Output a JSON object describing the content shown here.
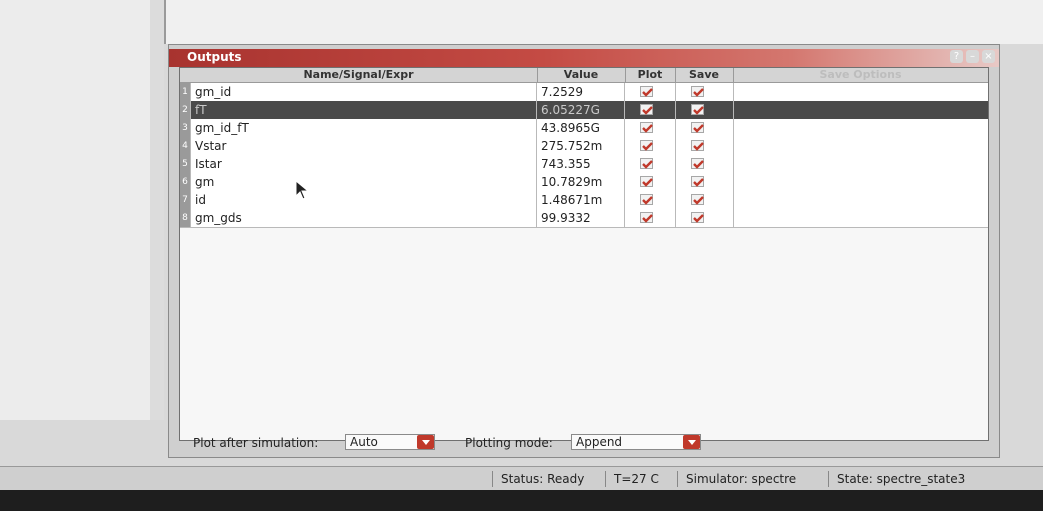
{
  "window": {
    "title": "Outputs",
    "controls": [
      "help-icon",
      "minimize-icon",
      "close-icon"
    ]
  },
  "table": {
    "columns": [
      "Name/Signal/Expr",
      "Value",
      "Plot",
      "Save",
      "Save Options"
    ],
    "rows": [
      {
        "num": "1",
        "name": "gm_id",
        "value": "7.2529",
        "plot": true,
        "save": true
      },
      {
        "num": "2",
        "name": "fT",
        "value": "6.05227G",
        "plot": true,
        "save": true,
        "selected": true
      },
      {
        "num": "3",
        "name": "gm_id_fT",
        "value": "43.8965G",
        "plot": true,
        "save": true
      },
      {
        "num": "4",
        "name": "Vstar",
        "value": "275.752m",
        "plot": true,
        "save": true
      },
      {
        "num": "5",
        "name": "Istar",
        "value": "743.355",
        "plot": true,
        "save": true
      },
      {
        "num": "6",
        "name": "gm",
        "value": "10.7829m",
        "plot": true,
        "save": true
      },
      {
        "num": "7",
        "name": "id",
        "value": "1.48671m",
        "plot": true,
        "save": true
      },
      {
        "num": "8",
        "name": "gm_gds",
        "value": "99.9332",
        "plot": true,
        "save": true
      }
    ]
  },
  "bottom": {
    "plot_after_label": "Plot after simulation:",
    "plot_after_value": "Auto",
    "plotting_mode_label": "Plotting mode:",
    "plotting_mode_value": "Append"
  },
  "status": {
    "status": "Status: Ready",
    "temp": "T=27 C",
    "simulator": "Simulator: spectre",
    "state": "State: spectre_state3"
  },
  "colors": {
    "title_bar": "#a8332f",
    "checkmark": "#c0392b",
    "selected_row": "#4a4a4a"
  }
}
